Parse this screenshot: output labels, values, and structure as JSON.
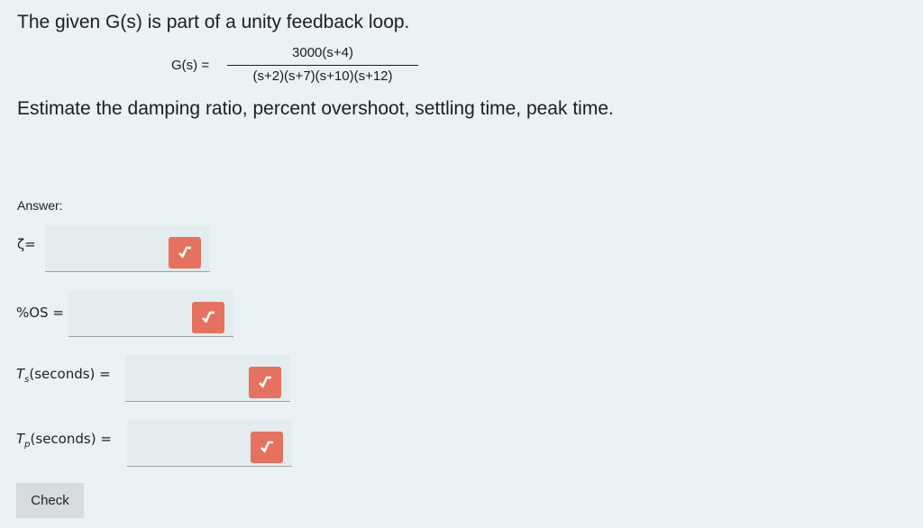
{
  "question": {
    "intro": "The given G(s) is part of a unity feedback loop.",
    "formula_lhs": "G(s) =",
    "formula_numerator": "3000(s+4)",
    "formula_denominator": "(s+2)(s+7)(s+10)(s+12)",
    "prompt": "Estimate the damping ratio, percent overshoot, settling time, peak time."
  },
  "answer": {
    "label": "Answer:",
    "fields": [
      {
        "label": "ζ=",
        "value": ""
      },
      {
        "label": "%OS =",
        "value": ""
      },
      {
        "label_main": "T",
        "label_sub": "s",
        "label_rest": "(seconds) =",
        "value": ""
      },
      {
        "label_main": "T",
        "label_sub": "p",
        "label_rest": "(seconds) =",
        "value": ""
      }
    ],
    "input_icon": "square-root-icon",
    "icon_color": "#e4725e"
  },
  "check_button": "Check"
}
